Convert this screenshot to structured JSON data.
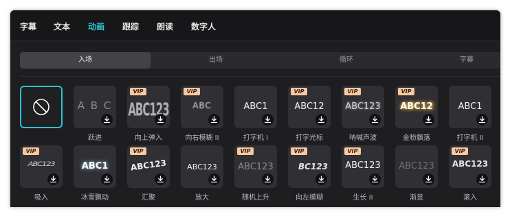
{
  "top_tabs": [
    "字幕",
    "文本",
    "动画",
    "跟踪",
    "朗读",
    "数字人"
  ],
  "active_top_tab": "动画",
  "sub_tabs": [
    "入场",
    "出场",
    "循环",
    "字幕"
  ],
  "active_sub_tab": "入场",
  "badge": "VIP",
  "colors": {
    "accent": "#2fc1cf",
    "vip_badge": "#f6c9a3",
    "panel_bg": "#1e1e21",
    "tile_bg": "#303034"
  },
  "icons": {
    "none": "prohibited-icon",
    "download": "download-icon"
  },
  "row1": [
    {
      "label": "",
      "preview": "",
      "vip": false,
      "none": true
    },
    {
      "label": "跃进",
      "preview": "A B C",
      "vip": false
    },
    {
      "label": "向上弹入",
      "preview": "ABC123",
      "vip": true
    },
    {
      "label": "向右模糊 II",
      "preview": "ABC",
      "vip": true
    },
    {
      "label": "打字机 I",
      "preview": "ABC1",
      "vip": false
    },
    {
      "label": "打字光标",
      "preview": "ABC12",
      "vip": true
    },
    {
      "label": "呐喊声波",
      "preview": "ABC123",
      "vip": true
    },
    {
      "label": "金粉飘落",
      "preview": "ABC12",
      "vip": true
    },
    {
      "label": "打字机 II",
      "preview": "ABC1",
      "vip": false
    }
  ],
  "row2": [
    {
      "label": "吸入",
      "preview": "ABC123",
      "vip": true
    },
    {
      "label": "冰雪飘动",
      "preview": "ABC1",
      "vip": false
    },
    {
      "label": "汇聚",
      "preview": "ABC123",
      "vip": true
    },
    {
      "label": "放大",
      "preview": "ABC123",
      "vip": false
    },
    {
      "label": "随机上升",
      "preview": "ABC123",
      "vip": true
    },
    {
      "label": "向左模糊",
      "preview": "BC123",
      "vip": true
    },
    {
      "label": "生长 II",
      "preview": "ABC123",
      "vip": true
    },
    {
      "label": "渐显",
      "preview": "ABC123",
      "vip": false
    },
    {
      "label": "滚入",
      "preview": "ABC123",
      "vip": true
    }
  ]
}
